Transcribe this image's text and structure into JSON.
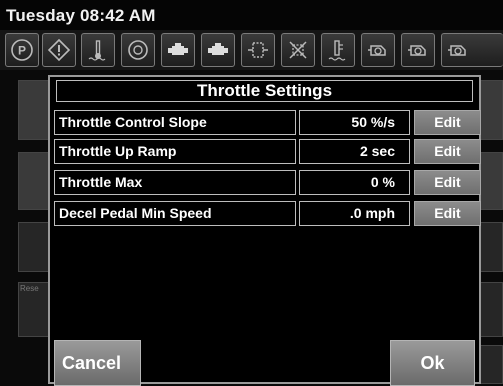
{
  "header": {
    "datetime": "Tuesday 08:42 AM"
  },
  "icon_bar": {
    "icons": [
      {
        "name": "parking-brake-icon"
      },
      {
        "name": "warning-icon"
      },
      {
        "name": "coolant-temperature-icon"
      },
      {
        "name": "engine-icon"
      },
      {
        "name": "engine-block-icon"
      },
      {
        "name": "engine-block-icon"
      },
      {
        "name": "aftertreatment-icon"
      },
      {
        "name": "exhaust-filter-icon"
      },
      {
        "name": "fluid-level-icon"
      },
      {
        "name": "engine-outline-icon"
      },
      {
        "name": "engine-outline-icon"
      }
    ]
  },
  "dialog": {
    "title": "Throttle Settings",
    "rows": [
      {
        "label": "Throttle Control Slope",
        "value": "50 %/s",
        "action": "Edit"
      },
      {
        "label": "Throttle Up Ramp",
        "value": "2 sec",
        "action": "Edit"
      },
      {
        "label": "Throttle Max",
        "value": "0 %",
        "action": "Edit"
      },
      {
        "label": "Decel Pedal Min Speed",
        "value": ".0 mph",
        "action": "Edit"
      }
    ],
    "cancel_label": "Cancel",
    "ok_label": "Ok"
  },
  "background": {
    "partial_label": "Rese"
  }
}
